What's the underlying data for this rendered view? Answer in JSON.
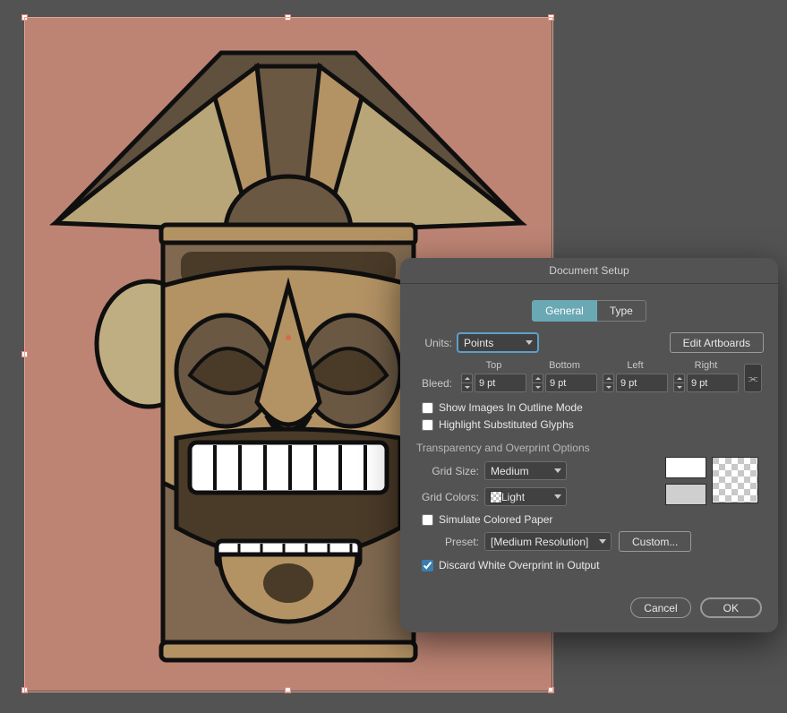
{
  "dialog": {
    "title": "Document Setup",
    "tabs": {
      "general": "General",
      "type": "Type"
    },
    "units_label": "Units:",
    "units_value": "Points",
    "edit_artboards": "Edit Artboards",
    "bleed_label": "Bleed:",
    "bleed_headers": {
      "top": "Top",
      "bottom": "Bottom",
      "left": "Left",
      "right": "Right"
    },
    "bleed_values": {
      "top": "9 pt",
      "bottom": "9 pt",
      "left": "9 pt",
      "right": "9 pt"
    },
    "show_images": "Show Images In Outline Mode",
    "highlight_glyphs": "Highlight Substituted Glyphs",
    "transparency_title": "Transparency and Overprint Options",
    "grid_size_label": "Grid Size:",
    "grid_size_value": "Medium",
    "grid_colors_label": "Grid Colors:",
    "grid_colors_value": "Light",
    "simulate_paper": "Simulate Colored Paper",
    "preset_label": "Preset:",
    "preset_value": "[Medium Resolution]",
    "custom": "Custom...",
    "discard_white": "Discard White Overprint in Output",
    "cancel": "Cancel",
    "ok": "OK"
  },
  "link_icon": "⫘"
}
